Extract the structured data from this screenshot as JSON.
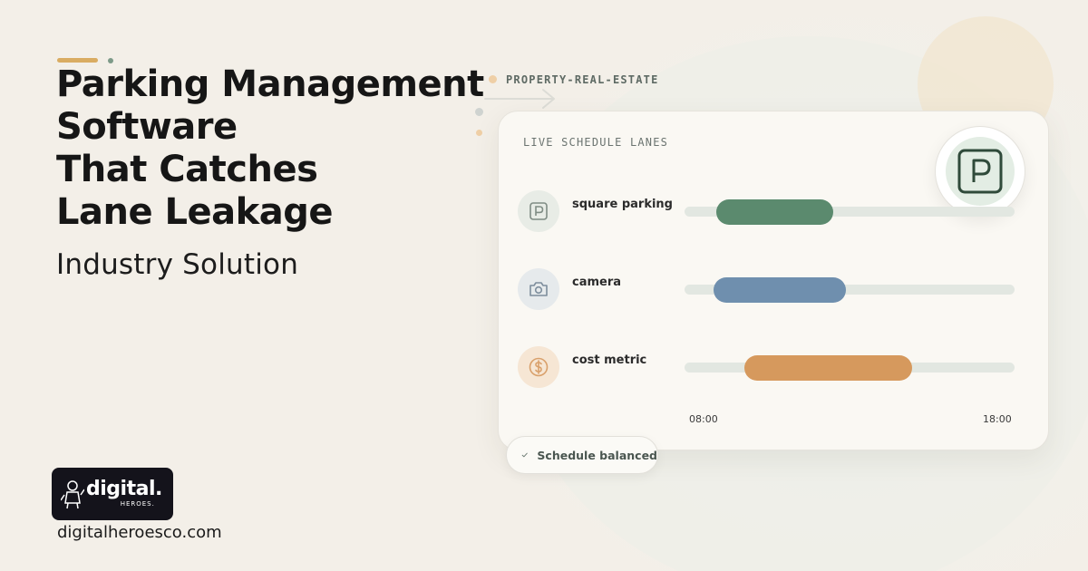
{
  "headline": {
    "lines": [
      "Parking Management",
      "Software",
      "That Catches",
      "Lane Leakage"
    ],
    "subtitle": "Industry Solution"
  },
  "brand": {
    "logo_word": "digital.",
    "logo_sub": "HEROES.",
    "url": "digitalheroesco.com"
  },
  "category": "PROPERTY-REAL-ESTATE",
  "card": {
    "title": "LIVE SCHEDULE LANES",
    "badge_icon": "parking-sign-icon",
    "lanes": [
      {
        "label": "square parking",
        "icon": "parking-sign-icon",
        "start": 0.095,
        "end": 0.45,
        "color": "#5b8a6e"
      },
      {
        "label": "camera",
        "icon": "camera-icon",
        "start": 0.088,
        "end": 0.49,
        "color": "#6f8fae"
      },
      {
        "label": "cost metric",
        "icon": "dollar-icon",
        "start": 0.18,
        "end": 0.69,
        "color": "#d6995d"
      }
    ],
    "axis": {
      "start": "08:00",
      "end": "18:00"
    }
  },
  "status": {
    "label": "Schedule balanced",
    "icon": "check-icon"
  },
  "colors": {
    "accent_gold": "#d9ac62",
    "accent_green": "#5b8a6e",
    "background": "#f3efe8"
  }
}
